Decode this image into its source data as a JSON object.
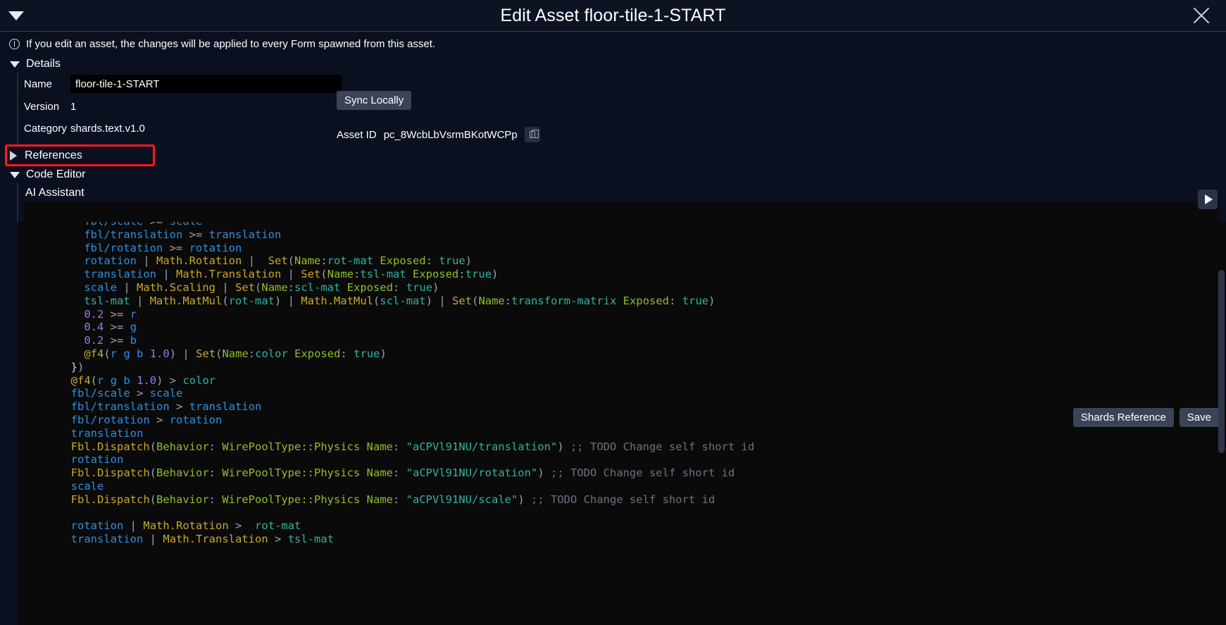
{
  "window": {
    "title": "Edit Asset floor-tile-1-START",
    "collapse_icon": "triangle-down-icon",
    "close_icon": "close-icon"
  },
  "notice": {
    "icon": "info-icon",
    "text": "If you edit an asset, the changes will be applied to every Form spawned from this asset."
  },
  "details": {
    "header": "Details",
    "header_icon": "triangle-down-icon",
    "name_label": "Name",
    "name_value": "floor-tile-1-START",
    "name_placeholder": "",
    "version_label": "Version",
    "version_value": "1",
    "category_label": "Category",
    "category_value": "shards.text.v1.0",
    "sync_button": "Sync Locally",
    "asset_id_label": "Asset ID",
    "asset_id_value": "pc_8WcbLbVsrmBKotWCPp",
    "copy_icon": "copy-icon"
  },
  "references": {
    "header": "References",
    "header_icon": "triangle-right-icon",
    "highlight_color": "#ff1a1a"
  },
  "code_editor": {
    "header": "Code Editor",
    "header_icon": "triangle-down-icon",
    "ai_assistant_label": "AI Assistant",
    "ai_input_value": "",
    "ai_input_placeholder": "",
    "run_icon": "play-icon",
    "shards_reference_button": "Shards Reference",
    "save_button": "Save"
  },
  "code": {
    "language": "shards",
    "lines": [
      "    fbl/scale >= scale",
      "    fbl/translation >= translation",
      "    fbl/rotation >= rotation",
      "    rotation | Math.Rotation |  Set(Name:rot-mat Exposed: true)",
      "    translation | Math.Translation | Set(Name:tsl-mat Exposed:true)",
      "    scale | Math.Scaling | Set(Name:scl-mat Exposed: true)",
      "    tsl-mat | Math.MatMul(rot-mat) | Math.MatMul(scl-mat) | Set(Name:transform-matrix Exposed: true)",
      "    0.2 >= r",
      "    0.4 >= g",
      "    0.2 >= b",
      "    @f4(r g b 1.0) | Set(Name:color Exposed: true)",
      "  })",
      "  @f4(r g b 1.0) > color",
      "  fbl/scale > scale",
      "  fbl/translation > translation",
      "  fbl/rotation > rotation",
      "  translation",
      "  Fbl.Dispatch(Behavior: WirePoolType::Physics Name: \"aCPVl91NU/translation\") ;; TODO Change self short id",
      "  rotation",
      "  Fbl.Dispatch(Behavior: WirePoolType::Physics Name: \"aCPVl91NU/rotation\") ;; TODO Change self short id",
      "  scale",
      "  Fbl.Dispatch(Behavior: WirePoolType::Physics Name: \"aCPVl91NU/scale\") ;; TODO Change self short id",
      "",
      "  rotation | Math.Rotation >  rot-mat",
      "  translation | Math.Translation > tsl-mat"
    ]
  }
}
